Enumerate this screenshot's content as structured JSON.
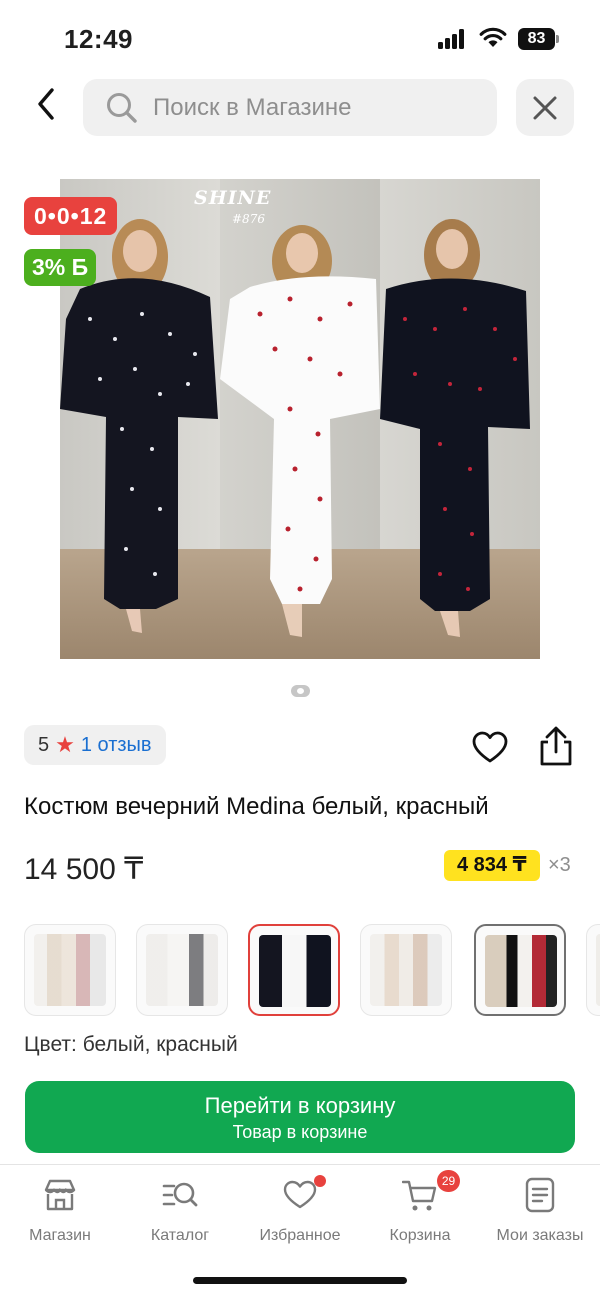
{
  "status_bar": {
    "time": "12:49",
    "battery": "83"
  },
  "search": {
    "placeholder": "Поиск в Магазине"
  },
  "product": {
    "image_brand": "SHINE",
    "image_code": "#876",
    "timer": "0•0•12",
    "bonus": "3% Б",
    "rating": "5",
    "reviews": "1 отзыв",
    "title": "Костюм вечерний Medina белый, красный",
    "price": "14 500 ₸",
    "installment": "4 834 ₸",
    "installment_count": "×3",
    "color_label": "Цвет: белый, красный"
  },
  "cart_button": {
    "title": "Перейти в корзину",
    "subtitle": "Товар в корзине"
  },
  "tabs": [
    {
      "label": "Магазин",
      "icon": "store-icon"
    },
    {
      "label": "Каталог",
      "icon": "catalog-search-icon"
    },
    {
      "label": "Избранное",
      "icon": "heart-icon"
    },
    {
      "label": "Корзина",
      "icon": "cart-icon",
      "badge": "29"
    },
    {
      "label": "Мои заказы",
      "icon": "orders-icon"
    }
  ],
  "colors": {
    "accent_green": "#11a851",
    "timer_red": "#e8423e",
    "bonus_green": "#4caf1e",
    "installment_yellow": "#ffe21f",
    "link_blue": "#1a6fd1"
  }
}
